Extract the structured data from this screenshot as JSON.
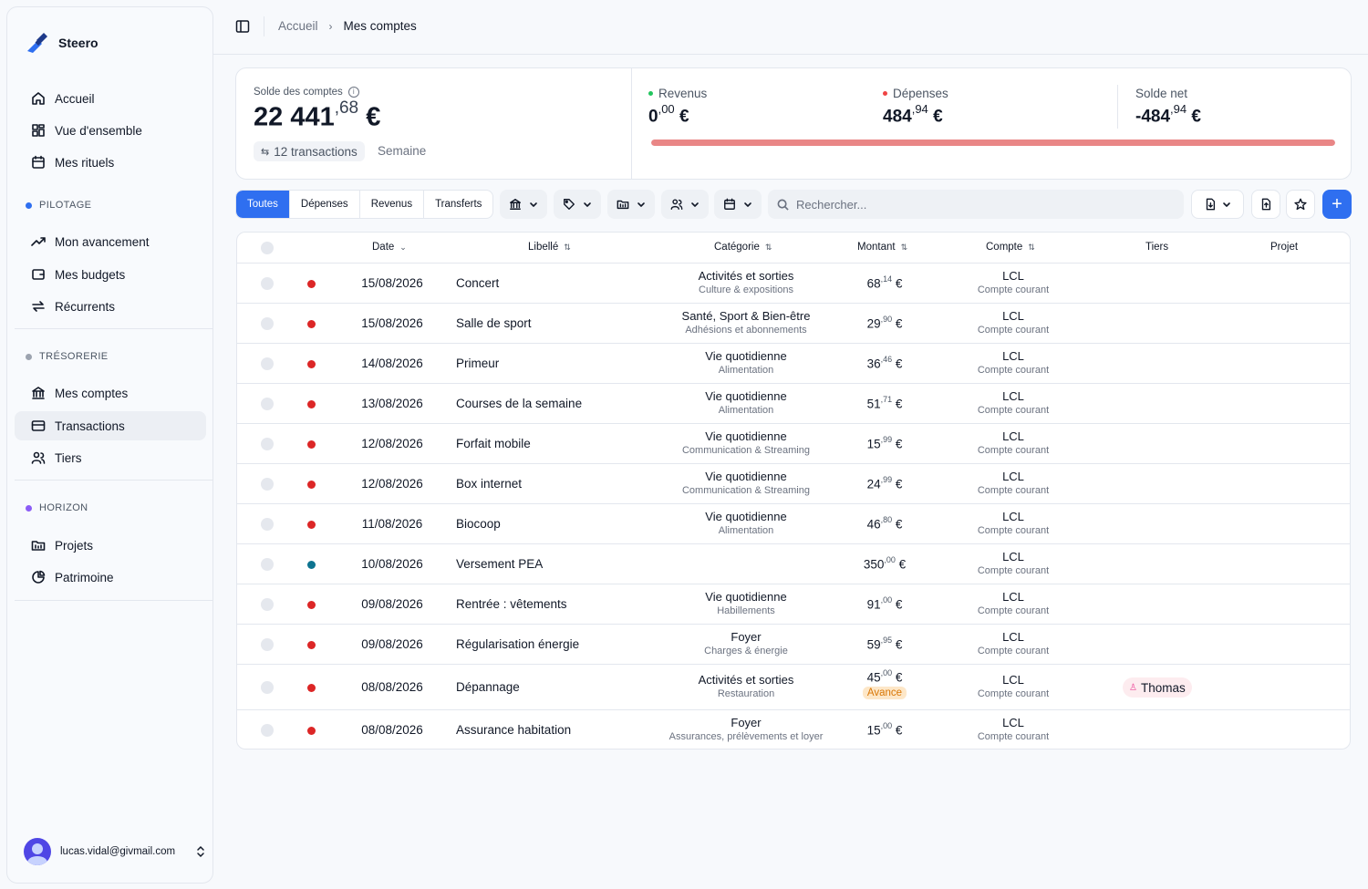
{
  "app": {
    "name": "Steero"
  },
  "colors": {
    "accent": "#2f6ff0",
    "expense": "#dc2626",
    "transfer": "#0e7490",
    "pilotage": "#2f6ff0",
    "tresorerie": "#9ca3af",
    "horizon": "#8b5cf6"
  },
  "sidebar": {
    "main": [
      {
        "label": "Accueil",
        "icon": "home-icon"
      },
      {
        "label": "Vue d'ensemble",
        "icon": "grid-icon"
      },
      {
        "label": "Mes rituels",
        "icon": "calendar-icon"
      }
    ],
    "sections": [
      {
        "title": "PILOTAGE",
        "items": [
          {
            "label": "Mon avancement",
            "icon": "trend-icon"
          },
          {
            "label": "Mes budgets",
            "icon": "wallet-icon"
          },
          {
            "label": "Récurrents",
            "icon": "repeat-icon"
          }
        ]
      },
      {
        "title": "TRÉSORERIE",
        "items": [
          {
            "label": "Mes comptes",
            "icon": "bank-icon"
          },
          {
            "label": "Transactions",
            "icon": "card-icon"
          },
          {
            "label": "Tiers",
            "icon": "users-icon"
          }
        ]
      },
      {
        "title": "HORIZON",
        "items": [
          {
            "label": "Projets",
            "icon": "folder-icon"
          },
          {
            "label": "Patrimoine",
            "icon": "pie-icon"
          }
        ]
      }
    ],
    "active": "Transactions",
    "user_email": "lucas.vidal@givmail.com"
  },
  "breadcrumb": {
    "home": "Accueil",
    "current": "Mes comptes"
  },
  "summary": {
    "label": "Solde des comptes",
    "balance_int": "22 441",
    "balance_dec": ",68",
    "currency": "€",
    "tx_count": "12 transactions",
    "period": "Semaine",
    "revenus_label": "Revenus",
    "revenus_int": "0",
    "revenus_dec": ",00",
    "depenses_label": "Dépenses",
    "depenses_int": "484",
    "depenses_dec": ",94",
    "solde_label": "Solde net",
    "solde_int": "-484",
    "solde_dec": ",94",
    "progress_expense_ratio": 1.0
  },
  "toolbar": {
    "tabs": [
      "Toutes",
      "Dépenses",
      "Revenus",
      "Transferts"
    ],
    "active_tab": "Toutes",
    "search_placeholder": "Rechercher..."
  },
  "table": {
    "headers": {
      "date": "Date",
      "label": "Libellé",
      "category": "Catégorie",
      "amount": "Montant",
      "account": "Compte",
      "tiers": "Tiers",
      "project": "Projet"
    },
    "rows": [
      {
        "type": "expense",
        "date": "15/08/2026",
        "label": "Concert",
        "cat": "Activités et sorties",
        "subcat": "Culture & expositions",
        "amount_int": "68",
        "amount_dec": ",14",
        "currency": "€",
        "account": "LCL",
        "account_type": "Compte courant"
      },
      {
        "type": "expense",
        "date": "15/08/2026",
        "label": "Salle de sport",
        "cat": "Santé, Sport & Bien-être",
        "subcat": "Adhésions et abonnements",
        "amount_int": "29",
        "amount_dec": ",90",
        "currency": "€",
        "account": "LCL",
        "account_type": "Compte courant"
      },
      {
        "type": "expense",
        "date": "14/08/2026",
        "label": "Primeur",
        "cat": "Vie quotidienne",
        "subcat": "Alimentation",
        "amount_int": "36",
        "amount_dec": ",46",
        "currency": "€",
        "account": "LCL",
        "account_type": "Compte courant"
      },
      {
        "type": "expense",
        "date": "13/08/2026",
        "label": "Courses de la semaine",
        "cat": "Vie quotidienne",
        "subcat": "Alimentation",
        "amount_int": "51",
        "amount_dec": ",71",
        "currency": "€",
        "account": "LCL",
        "account_type": "Compte courant"
      },
      {
        "type": "expense",
        "date": "12/08/2026",
        "label": "Forfait mobile",
        "cat": "Vie quotidienne",
        "subcat": "Communication & Streaming",
        "amount_int": "15",
        "amount_dec": ",99",
        "currency": "€",
        "account": "LCL",
        "account_type": "Compte courant"
      },
      {
        "type": "expense",
        "date": "12/08/2026",
        "label": "Box internet",
        "cat": "Vie quotidienne",
        "subcat": "Communication & Streaming",
        "amount_int": "24",
        "amount_dec": ",99",
        "currency": "€",
        "account": "LCL",
        "account_type": "Compte courant"
      },
      {
        "type": "expense",
        "date": "11/08/2026",
        "label": "Biocoop",
        "cat": "Vie quotidienne",
        "subcat": "Alimentation",
        "amount_int": "46",
        "amount_dec": ",80",
        "currency": "€",
        "account": "LCL",
        "account_type": "Compte courant"
      },
      {
        "type": "transfer",
        "date": "10/08/2026",
        "label": "Versement PEA",
        "cat": "",
        "subcat": "",
        "amount_int": "350",
        "amount_dec": ",00",
        "currency": "€",
        "account": "LCL",
        "account_type": "Compte courant"
      },
      {
        "type": "expense",
        "date": "09/08/2026",
        "label": "Rentrée : vêtements",
        "cat": "Vie quotidienne",
        "subcat": "Habillements",
        "amount_int": "91",
        "amount_dec": ",00",
        "currency": "€",
        "account": "LCL",
        "account_type": "Compte courant"
      },
      {
        "type": "expense",
        "date": "09/08/2026",
        "label": "Régularisation énergie",
        "cat": "Foyer",
        "subcat": "Charges & énergie",
        "amount_int": "59",
        "amount_dec": ",95",
        "currency": "€",
        "account": "LCL",
        "account_type": "Compte courant"
      },
      {
        "type": "expense",
        "date": "08/08/2026",
        "label": "Dépannage",
        "cat": "Activités et sorties",
        "subcat": "Restauration",
        "amount_int": "45",
        "amount_dec": ",00",
        "currency": "€",
        "badge": "Avance",
        "account": "LCL",
        "account_type": "Compte courant",
        "tiers": "Thomas"
      },
      {
        "type": "expense",
        "date": "08/08/2026",
        "label": "Assurance habitation",
        "cat": "Foyer",
        "subcat": "Assurances, prélèvements et loyer",
        "amount_int": "15",
        "amount_dec": ",00",
        "currency": "€",
        "account": "LCL",
        "account_type": "Compte courant"
      }
    ]
  }
}
